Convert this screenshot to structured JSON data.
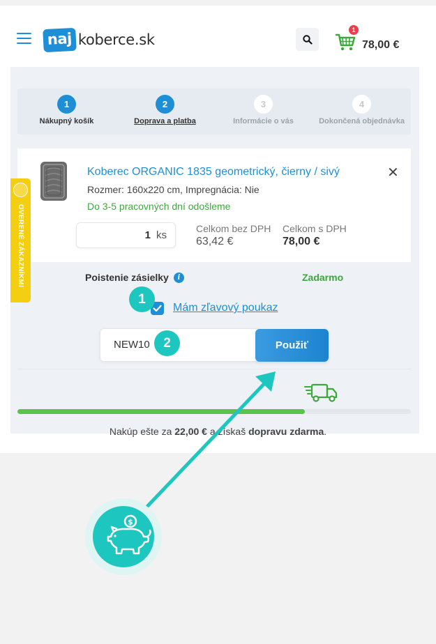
{
  "header": {
    "logo_prefix": "naj",
    "logo_suffix": "koberce.sk",
    "cart_count": "1",
    "cart_total": "78,00 €"
  },
  "steps": [
    {
      "num": "1",
      "label": "Nákupný košík",
      "state": "done"
    },
    {
      "num": "2",
      "label": "Doprava a platba",
      "state": "current"
    },
    {
      "num": "3",
      "label": "Informácie o vás",
      "state": "todo"
    },
    {
      "num": "4",
      "label": "Dokončená objednávka",
      "state": "todo"
    }
  ],
  "product": {
    "title": "Koberec ORGANIC 1835 geometrický, čierny / sivý",
    "size": "Rozmer: 160x220 cm, Impregnácia: Nie",
    "delivery": "Do 3-5 pracovných dní odošleme",
    "qty": "1",
    "qty_unit": "ks",
    "price_ex_label": "Celkom bez DPH",
    "price_ex_value": "63,42 €",
    "price_inc_label": "Celkom s DPH",
    "price_inc_value": "78,00 €"
  },
  "insurance": {
    "label": "Poistenie zásielky",
    "value": "Zadarmo"
  },
  "discount": {
    "label": "Mám zľavový poukaz",
    "checked": true,
    "code": "NEW10",
    "apply_label": "Použiť"
  },
  "annotations": {
    "one": "1",
    "two": "2"
  },
  "shipping": {
    "progress": 0.73,
    "prefix": "Nakúp ešte za ",
    "amount": "22,00 €",
    "middle": " a získaš ",
    "emphasis": "dopravu zdarma",
    "suffix": "."
  },
  "side_badge": {
    "label": "OVERENÉ ZÁKAZNÍKMI"
  },
  "colors": {
    "brand_blue": "#1e8fd6",
    "accent_teal": "#1ec6c0",
    "success_green": "#3ca83c",
    "badge_yellow": "#f4cf11"
  },
  "icons": [
    "hamburger-icon",
    "search-icon",
    "cart-icon",
    "info-icon",
    "check-icon",
    "close-icon",
    "truck-icon",
    "piggy-bank-icon"
  ]
}
